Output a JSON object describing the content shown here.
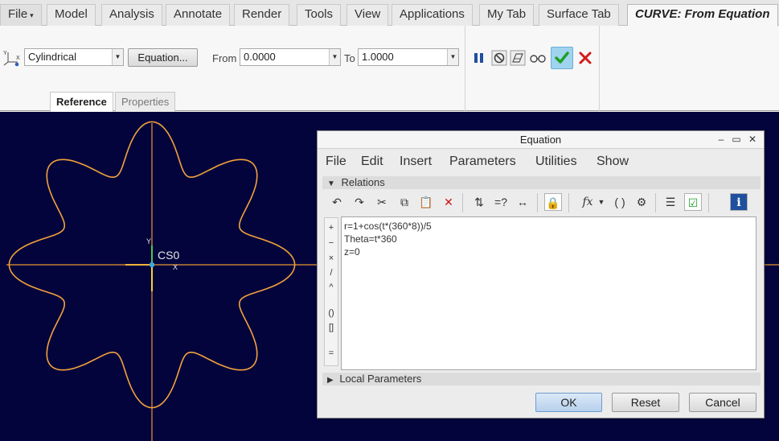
{
  "ribbon_tabs": [
    "File",
    "Model",
    "Analysis",
    "Annotate",
    "Render",
    "Tools",
    "View",
    "Applications",
    "My Tab",
    "Surface Tab",
    "CURVE: From Equation"
  ],
  "controls": {
    "coord_type": "Cylindrical",
    "equation_button": "Equation...",
    "from_label": "From",
    "from_value": "0.0000",
    "to_label": "To",
    "to_value": "1.0000"
  },
  "subtabs": [
    "Reference",
    "Properties"
  ],
  "viewport": {
    "csys_label": "CS0",
    "axis_y": "Y",
    "axis_x": "X"
  },
  "dialog": {
    "title": "Equation",
    "menu": [
      "File",
      "Edit",
      "Insert",
      "Parameters",
      "Utilities",
      "Show"
    ],
    "relations_label": "Relations",
    "local_params_label": "Local Parameters",
    "operators": [
      "+",
      "−",
      "×",
      "/",
      "^",
      "()",
      "[]",
      "="
    ],
    "equation_lines": [
      "r=1+cos(t*(360*8))/5",
      "Theta=t*360",
      "z=0"
    ],
    "ok": "OK",
    "reset": "Reset",
    "cancel": "Cancel"
  },
  "colors": {
    "viewport_bg": "#04043d",
    "curve": "#f2a33a",
    "accept": "#1f9e24",
    "reject": "#d21a1a"
  }
}
